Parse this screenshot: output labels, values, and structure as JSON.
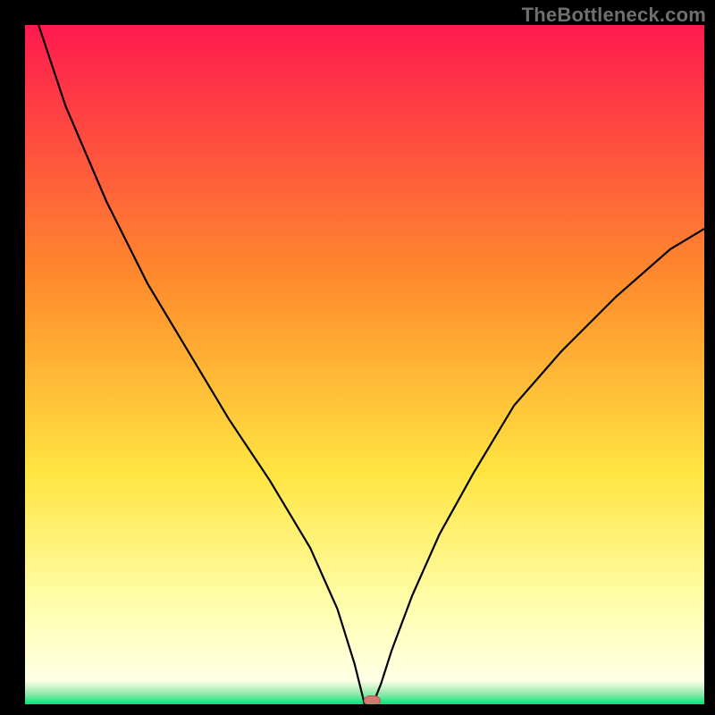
{
  "watermark": "TheBottleneck.com",
  "colors": {
    "frame_bg": "#000000",
    "gradient_top": "#ff1a4f",
    "gradient_mid1": "#ff8d2c",
    "gradient_mid2": "#ffe541",
    "gradient_mid3": "#ffffb0",
    "gradient_bottom": "#00e57a",
    "curve": "#000000",
    "marker_fill": "#d17a6f",
    "marker_stroke": "#b45c52"
  },
  "chart_data": {
    "type": "line",
    "title": "",
    "xlabel": "",
    "ylabel": "",
    "xlim": [
      0,
      100
    ],
    "ylim": [
      0,
      100
    ],
    "grid": false,
    "legend_position": "none",
    "series": [
      {
        "name": "bottleneck-curve",
        "x": [
          2,
          6,
          12,
          18,
          24,
          30,
          36,
          42,
          46,
          48.5,
          49.5,
          50,
          50.8,
          51.6,
          52.4,
          54,
          57,
          61,
          66,
          72,
          79,
          87,
          95,
          100
        ],
        "y": [
          100,
          88,
          74,
          62,
          52,
          42,
          33,
          23,
          14,
          6,
          2,
          0,
          0,
          1,
          3,
          8,
          16,
          25,
          34,
          44,
          52,
          60,
          67,
          70
        ]
      }
    ],
    "marker": {
      "x": 51,
      "y": 0.5,
      "shape": "rounded-rect"
    },
    "gradient_stops": [
      {
        "pos": 0.0,
        "color": "#ff1a4f"
      },
      {
        "pos": 0.38,
        "color": "#ff8d2c"
      },
      {
        "pos": 0.66,
        "color": "#ffe541"
      },
      {
        "pos": 0.86,
        "color": "#ffffb0"
      },
      {
        "pos": 0.965,
        "color": "#ffffe6"
      },
      {
        "pos": 0.985,
        "color": "#8fe9a9"
      },
      {
        "pos": 1.0,
        "color": "#00e57a"
      }
    ]
  }
}
